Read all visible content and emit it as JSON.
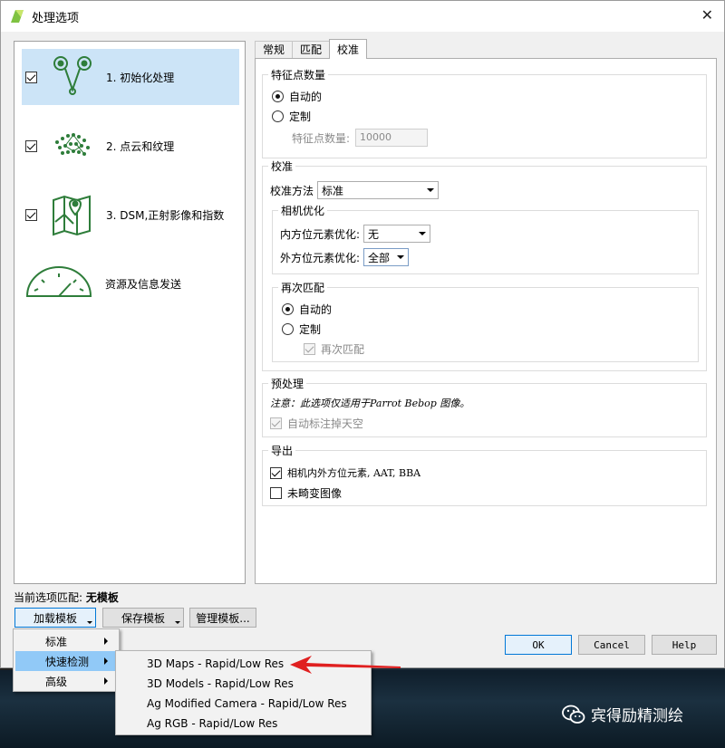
{
  "window": {
    "title": "处理选项",
    "close_glyph": "✕"
  },
  "steps": [
    {
      "label": "1. 初始化处理",
      "checked": true,
      "icon": "initial-processing-icon"
    },
    {
      "label": "2. 点云和纹理",
      "checked": true,
      "icon": "point-cloud-icon"
    },
    {
      "label": "3. DSM,正射影像和指数",
      "checked": true,
      "icon": "dsm-map-icon"
    },
    {
      "label": "资源及信息发送",
      "icon": "gauge-icon"
    }
  ],
  "tabs": [
    {
      "label": "常规"
    },
    {
      "label": "匹配"
    },
    {
      "label": "校准",
      "active": true
    }
  ],
  "keypoints": {
    "title": "特征点数量",
    "auto_label": "自动的",
    "custom_label": "定制",
    "count_label": "特征点数量:",
    "count_value": "10000"
  },
  "calibration": {
    "title": "校准",
    "method_label": "校准方法",
    "method_value": "标准",
    "camera_title": "相机优化",
    "internal_label": "内方位元素优化:",
    "internal_value": "无",
    "external_label": "外方位元素优化:",
    "external_value": "全部",
    "rematch_title": "再次匹配",
    "rematch_auto": "自动的",
    "rematch_custom": "定制",
    "rematch_checkbox": "再次匹配"
  },
  "preprocess": {
    "title": "预处理",
    "note": "注意：此选项仅适用于Parrot Bebop 图像。",
    "sky_label": "自动标注掉天空"
  },
  "export": {
    "title": "导出",
    "camera_params": "相机内外方位元素, AAT, BBA",
    "undistorted": "未畸变图像"
  },
  "footer": {
    "current_label": "当前选项匹配:",
    "current_value": "无模板",
    "load_template": "加载模板",
    "save_template": "保存模板",
    "manage_template": "管理模板...",
    "ok": "OK",
    "cancel": "Cancel",
    "help": "Help"
  },
  "menu": {
    "items": [
      "标准",
      "快速检测",
      "高级"
    ],
    "submenu": [
      "3D Maps - Rapid/Low Res",
      "3D Models - Rapid/Low Res",
      "Ag Modified Camera - Rapid/Low Res",
      "Ag RGB - Rapid/Low Res"
    ]
  },
  "watermark": {
    "text": "宾得励精测绘"
  },
  "colors": {
    "selection": "#cce4f7",
    "menu_highlight": "#91c9f7",
    "icon_green": "#2e7d3a",
    "arrow_red": "#e02020"
  }
}
